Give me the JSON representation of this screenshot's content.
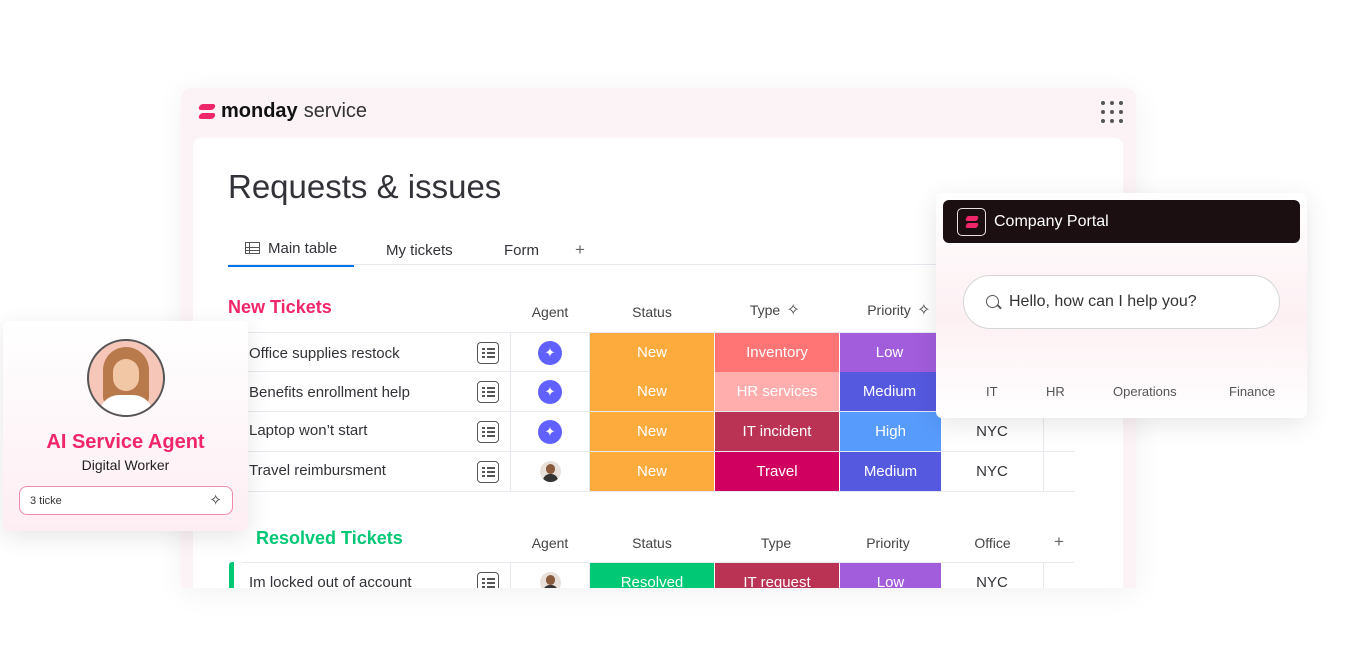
{
  "app": {
    "brand_bold": "monday",
    "brand_light": "service"
  },
  "page": {
    "title": "Requests & issues"
  },
  "tabs": [
    {
      "label": "Main table"
    },
    {
      "label": "My tickets"
    },
    {
      "label": "Form"
    },
    {
      "label": "+"
    }
  ],
  "new_group": {
    "title": "New Tickets",
    "color": "#f0266b",
    "columns": {
      "agent": "Agent",
      "status": "Status",
      "type": "Type",
      "priority": "Priority",
      "sparkle": "✧"
    },
    "rows": [
      {
        "name": "Office supplies restock",
        "agent": "ai",
        "status": "New",
        "type": "Inventory",
        "priority": "Low",
        "office": ""
      },
      {
        "name": "Benefits enrollment help",
        "agent": "ai",
        "status": "New",
        "type": "HR services",
        "priority": "Medium",
        "office": ""
      },
      {
        "name": "Laptop won’t start",
        "agent": "ai",
        "status": "New",
        "type": "IT incident",
        "priority": "High",
        "office": "NYC"
      },
      {
        "name": "Travel reimbursment",
        "agent": "person",
        "status": "New",
        "type": "Travel",
        "priority": "Medium",
        "office": "NYC"
      }
    ]
  },
  "resolved_group": {
    "title": "Resolved Tickets",
    "color": "#00c875",
    "columns": {
      "agent": "Agent",
      "status": "Status",
      "type": "Type",
      "priority": "Priority",
      "office": "Office",
      "add": "+"
    },
    "rows": [
      {
        "name": "Im locked out of account",
        "agent": "person",
        "status": "Resolved",
        "type": "IT request",
        "priority": "Low",
        "office": "NYC"
      }
    ]
  },
  "colors": {
    "status_new": "#fdab3d",
    "status_resolved": "#00c875",
    "type_inventory": "#ff7575",
    "type_hr": "#ffadad",
    "type_it_incident": "#bb3354",
    "type_travel": "#d00060",
    "type_it_request": "#bb3354",
    "priority_low": "#a25ddc",
    "priority_medium": "#5559df",
    "priority_high": "#579bfc"
  },
  "agent_card": {
    "title": "AI Service Agent",
    "subtitle": "Digital Worker",
    "input_text": "3 ticke",
    "input_icon": "sparkle-icon"
  },
  "portal": {
    "title": "Company Portal",
    "search_placeholder": "Hello, how can I help you?",
    "categories": [
      "IT",
      "HR",
      "Operations",
      "Finance"
    ]
  }
}
